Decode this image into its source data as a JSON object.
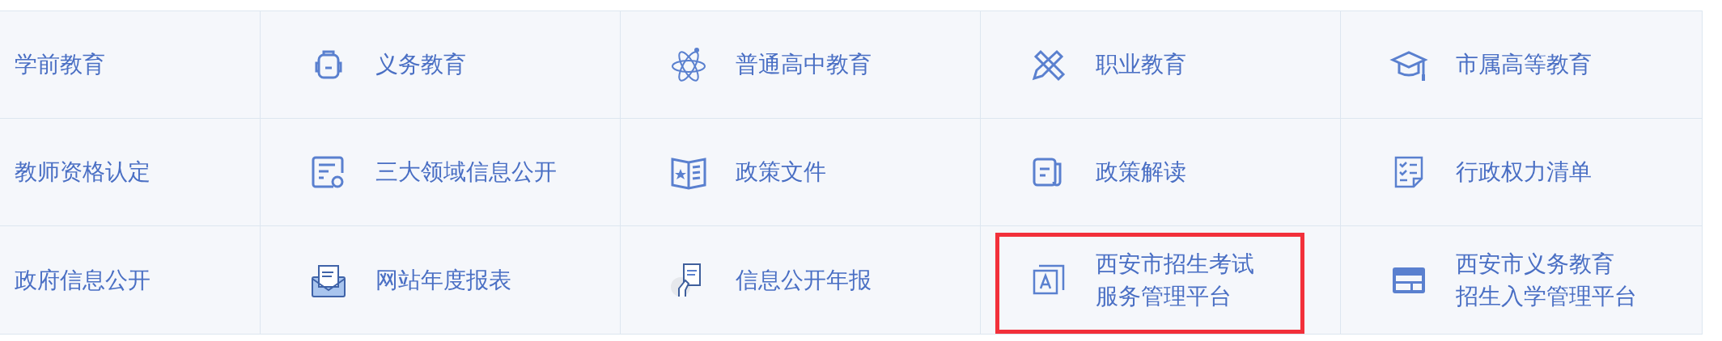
{
  "rows": [
    {
      "cells": [
        {
          "kind": "plain",
          "label": "学前教育",
          "highlighted": false
        },
        {
          "kind": "icon",
          "label": "义务教育",
          "highlighted": false
        },
        {
          "kind": "icon",
          "label": "普通高中教育",
          "highlighted": false
        },
        {
          "kind": "icon",
          "label": "职业教育",
          "highlighted": false
        },
        {
          "kind": "icon",
          "label": "市属高等教育",
          "highlighted": false
        }
      ]
    },
    {
      "cells": [
        {
          "kind": "plain",
          "label": "教师资格认定",
          "highlighted": false
        },
        {
          "kind": "icon",
          "label": "三大领域信息公开",
          "highlighted": false
        },
        {
          "kind": "icon",
          "label": "政策文件",
          "highlighted": false
        },
        {
          "kind": "icon",
          "label": "政策解读",
          "highlighted": false
        },
        {
          "kind": "icon",
          "label": "行政权力清单",
          "highlighted": false
        }
      ]
    },
    {
      "cells": [
        {
          "kind": "plain",
          "label": "政府信息公开",
          "highlighted": false
        },
        {
          "kind": "icon",
          "label": "网站年度报表",
          "highlighted": false
        },
        {
          "kind": "icon",
          "label": "信息公开年报",
          "highlighted": false
        },
        {
          "kind": "icon",
          "lines": [
            "西安市招生考试",
            "服务管理平台"
          ],
          "highlighted": true
        },
        {
          "kind": "icon",
          "lines": [
            "西安市义务教育",
            "招生入学管理平台"
          ],
          "highlighted": false
        }
      ]
    }
  ]
}
